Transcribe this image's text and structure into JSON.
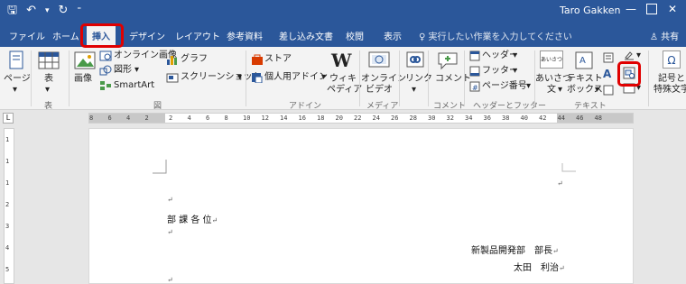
{
  "titlebar": {
    "user": "Taro Gakken",
    "qat": {
      "save": "🖫",
      "undo": "↶",
      "undo_drop": "▾",
      "redo": "↻",
      "customize": "⁼"
    },
    "window": {
      "minimize": "—",
      "maximize": "",
      "close": "✕"
    }
  },
  "tabs": [
    "ファイル",
    "ホーム",
    "挿入",
    "デザイン",
    "レイアウト",
    "参考資料",
    "差し込み文書",
    "校閲",
    "表示"
  ],
  "active_tab": "挿入",
  "tellme": "♀ 実行したい作業を入力してください",
  "share": "♙ 共有",
  "ribbon": {
    "pages_label": "ページ",
    "table_label": "表",
    "image_label": "画像",
    "online_image_label": "オンライン画像",
    "shapes_label": "図形",
    "smartart_label": "SmartArt",
    "graph_label": "グラフ",
    "screenshot_label": "スクリーンショット",
    "store_label": "ストア",
    "myaddins_label": "個人用アドイン",
    "wiki_label_1": "ウィキ",
    "wiki_label_2": "ペディア",
    "online_video_1": "オンライン",
    "online_video_2": "ビデオ",
    "link_label": "リンク",
    "comment_label": "コメント",
    "header_label": "ヘッダー",
    "footer_label": "フッター",
    "page_number_label": "ページ番号",
    "greeting_1": "あいさつ",
    "greeting_2": "文",
    "textbox_1": "テキスト",
    "textbox_2": "ボックス",
    "symbol_1": "記号と",
    "symbol_2": "特殊文字",
    "dropdown": "▾",
    "groups": {
      "table": "表",
      "figure": "図",
      "addins": "アドイン",
      "media": "メディア",
      "comment": "コメント",
      "header_footer": "ヘッダーとフッター",
      "text": "テキスト"
    },
    "icons": {
      "wiki_w": "W",
      "greeting_icon": "あいさつ",
      "text_a": "A",
      "symbol_icon": "Ω"
    }
  },
  "ruler": {
    "tab_selector": "L",
    "numbers": [
      "8",
      "6",
      "4",
      "2",
      "2",
      "4",
      "6",
      "8",
      "10",
      "12",
      "14",
      "16",
      "18",
      "20",
      "22",
      "24",
      "26",
      "28",
      "30",
      "32",
      "34",
      "36",
      "38",
      "40",
      "42",
      "44",
      "46",
      "48"
    ]
  },
  "vruler": {
    "numbers": [
      "1",
      "1",
      "1",
      "2",
      "3",
      "4",
      "5"
    ]
  },
  "document": {
    "line1": "部 課 各 位",
    "dept": "新製品開発部　部長",
    "name": "太田　利治",
    "pilcrow": "↵"
  },
  "colors": {
    "accent": "#2b579a",
    "highlight": "#e00000"
  }
}
